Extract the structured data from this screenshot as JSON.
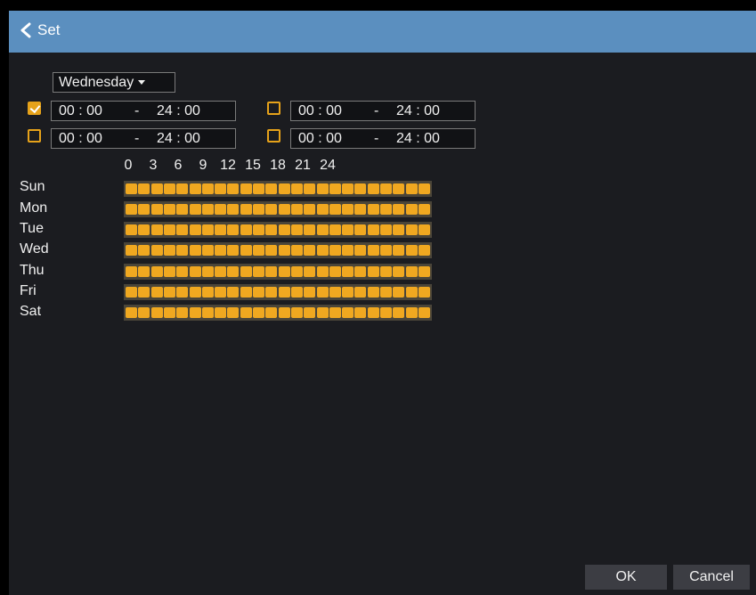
{
  "title": "Set",
  "day_select": {
    "value": "Wednesday"
  },
  "periods": [
    {
      "enabled": true,
      "start": "00 : 00",
      "sep": "-",
      "end": "24 : 00"
    },
    {
      "enabled": false,
      "start": "00 : 00",
      "sep": "-",
      "end": "24 : 00"
    },
    {
      "enabled": false,
      "start": "00 : 00",
      "sep": "-",
      "end": "24 : 00"
    },
    {
      "enabled": false,
      "start": "00 : 00",
      "sep": "-",
      "end": "24 : 00"
    }
  ],
  "hour_labels": [
    "0",
    "3",
    "6",
    "9",
    "12",
    "15",
    "18",
    "21",
    "24"
  ],
  "days": [
    "Sun",
    "Mon",
    "Tue",
    "Wed",
    "Thu",
    "Fri",
    "Sat"
  ],
  "schedule_hours_per_day": 24,
  "buttons": {
    "ok": "OK",
    "cancel": "Cancel"
  },
  "colors": {
    "title_bar": "#5b8fbf",
    "accent": "#e6a21a",
    "cell": "#f0a820",
    "background": "#1b1c20"
  },
  "icons": {
    "back": "chevron-left-icon",
    "dropdown": "caret-down-icon",
    "checkbox": "check-icon"
  }
}
